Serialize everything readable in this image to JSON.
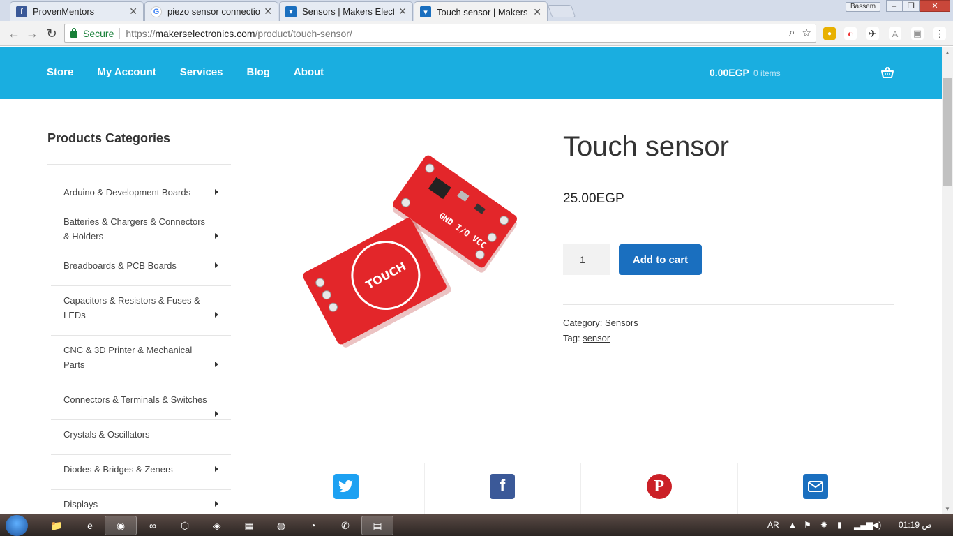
{
  "browser": {
    "tabs": [
      {
        "title": "ProvenMentors",
        "icon": "facebook-icon"
      },
      {
        "title": "piezo sensor connection",
        "icon": "google-icon"
      },
      {
        "title": "Sensors | Makers Electron",
        "icon": "makers-icon"
      },
      {
        "title": "Touch sensor | Makers El",
        "icon": "makers-icon",
        "active": true
      }
    ],
    "profile": "Bassem",
    "secure_label": "Secure",
    "url_prefix": "https://",
    "url_host": "makerselectronics.com",
    "url_path": "/product/touch-sensor/"
  },
  "site": {
    "nav": [
      "Store",
      "My Account",
      "Services",
      "Blog",
      "About"
    ],
    "cart_total": "0.00EGP",
    "cart_count": "0 items",
    "accent_color": "#1aaee0"
  },
  "sidebar": {
    "title": "Products Categories",
    "categories": [
      {
        "label": "Arduino & Development Boards",
        "has_sub": true
      },
      {
        "label": "Batteries & Chargers & Connectors & Holders",
        "has_sub": true
      },
      {
        "label": "Breadboards & PCB Boards",
        "has_sub": true
      },
      {
        "label": "Capacitors & Resistors & Fuses & LEDs",
        "has_sub": true
      },
      {
        "label": "CNC & 3D Printer & Mechanical Parts",
        "has_sub": true
      },
      {
        "label": "Connectors & Terminals & Switches",
        "has_sub": true
      },
      {
        "label": "Crystals & Oscillators",
        "has_sub": false
      },
      {
        "label": "Diodes & Bridges & Zeners",
        "has_sub": true
      },
      {
        "label": "Displays",
        "has_sub": true
      }
    ]
  },
  "product": {
    "title": "Touch sensor",
    "price": "25.00EGP",
    "quantity": "1",
    "add_to_cart": "Add to cart",
    "category_label": "Category:",
    "category": "Sensors",
    "tag_label": "Tag:",
    "tag": "sensor",
    "board_pad_text": "TOUCH",
    "board_pins": "GND I/O VCC"
  },
  "share": [
    "twitter-icon",
    "facebook-icon",
    "pinterest-icon",
    "email-icon"
  ],
  "taskbar": {
    "lang": "AR",
    "time": "01:19 ص"
  }
}
